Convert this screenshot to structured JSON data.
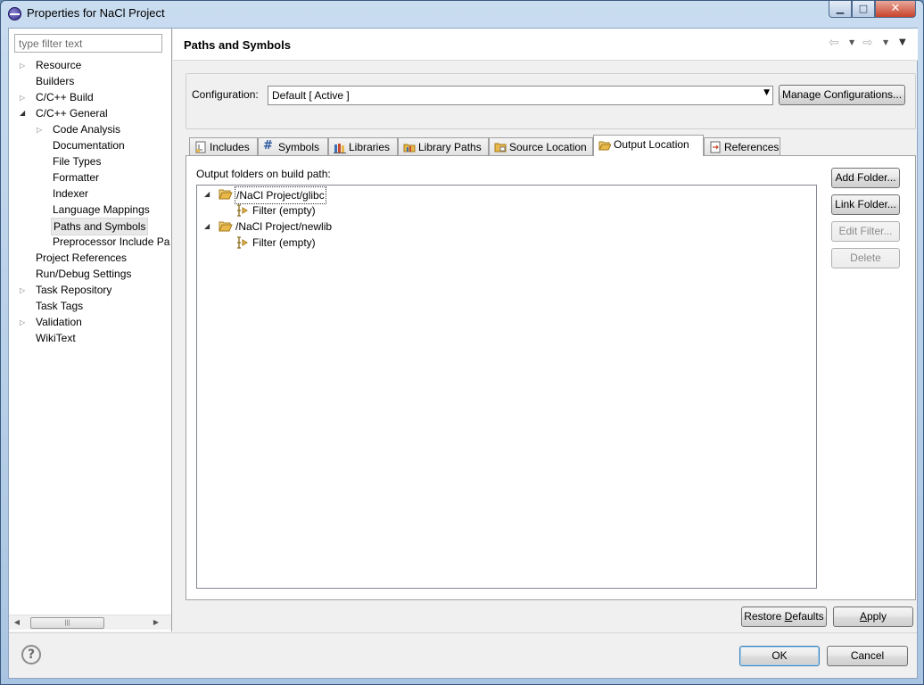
{
  "window": {
    "title": "Properties for NaCl Project",
    "minimize_glyph": "▁",
    "maximize_glyph": "□",
    "close_glyph": "✕"
  },
  "filter": {
    "placeholder": "type filter text"
  },
  "tree": {
    "items": [
      {
        "label": "Resource",
        "expandable": "collapsed"
      },
      {
        "label": "Builders"
      },
      {
        "label": "C/C++ Build",
        "expandable": "collapsed"
      },
      {
        "label": "C/C++ General",
        "expandable": "expanded"
      },
      {
        "label": "Code Analysis",
        "expandable": "collapsed"
      },
      {
        "label": "Documentation"
      },
      {
        "label": "File Types"
      },
      {
        "label": "Formatter"
      },
      {
        "label": "Indexer"
      },
      {
        "label": "Language Mappings"
      },
      {
        "label": "Paths and Symbols",
        "selected": true
      },
      {
        "label": "Preprocessor Include Pa"
      },
      {
        "label": "Project References"
      },
      {
        "label": "Run/Debug Settings"
      },
      {
        "label": "Task Repository",
        "expandable": "collapsed"
      },
      {
        "label": "Task Tags"
      },
      {
        "label": "Validation",
        "expandable": "collapsed"
      },
      {
        "label": "WikiText"
      }
    ]
  },
  "page": {
    "title": "Paths and Symbols"
  },
  "configuration": {
    "label": "Configuration:",
    "value": "Default  [ Active ]",
    "manage_button": "Manage Configurations..."
  },
  "tabs": [
    {
      "label": "Includes",
      "icon": "includes-icon"
    },
    {
      "label": "Symbols",
      "icon": "hash-icon"
    },
    {
      "label": "Libraries",
      "icon": "libraries-icon"
    },
    {
      "label": "Library Paths",
      "icon": "library-paths-icon"
    },
    {
      "label": "Source Location",
      "icon": "source-folder-icon"
    },
    {
      "label": "Output Location",
      "icon": "output-folder-icon",
      "active": true
    },
    {
      "label": "References",
      "icon": "references-icon"
    }
  ],
  "output_location": {
    "label": "Output folders on build path:",
    "folders": [
      {
        "path": "/NaCl Project/glibc",
        "filter": "Filter (empty)"
      },
      {
        "path": "/NaCl Project/newlib",
        "filter": "Filter (empty)"
      }
    ],
    "buttons": {
      "add_folder": "Add Folder...",
      "link_folder": "Link Folder...",
      "edit_filter": "Edit Filter...",
      "delete": "Delete"
    }
  },
  "footer": {
    "restore_defaults_pre": "Restore ",
    "restore_defaults_u": "D",
    "restore_defaults_post": "efaults",
    "apply_u": "A",
    "apply_post": "pply",
    "ok": "OK",
    "cancel": "Cancel",
    "help": "?"
  },
  "colors": {
    "accent": "#3c7fb1",
    "folder": "#e8b84a",
    "titlebar": "#b9d1ea"
  }
}
